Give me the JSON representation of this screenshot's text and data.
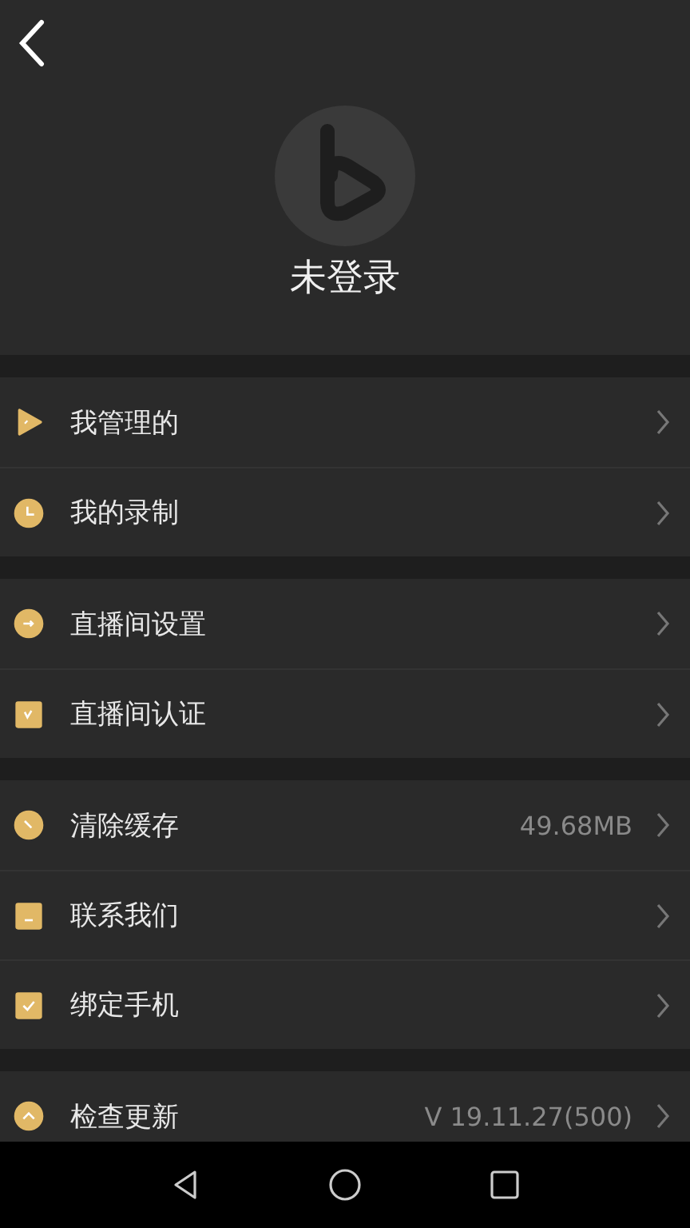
{
  "header": {
    "status": "未登录"
  },
  "groups": [
    {
      "items": [
        {
          "label": "我管理的"
        },
        {
          "label": "我的录制"
        }
      ]
    },
    {
      "items": [
        {
          "label": "直播间设置"
        },
        {
          "label": "直播间认证"
        }
      ]
    },
    {
      "items": [
        {
          "label": "清除缓存",
          "value": "49.68MB"
        },
        {
          "label": "联系我们"
        },
        {
          "label": "绑定手机"
        }
      ]
    },
    {
      "items": [
        {
          "label": "检查更新",
          "value": "V 19.11.27(500)"
        }
      ]
    }
  ]
}
